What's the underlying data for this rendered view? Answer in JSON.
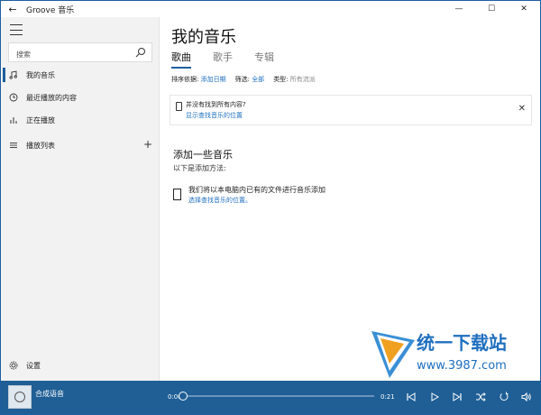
{
  "window": {
    "title": "Groove 音乐",
    "back_glyph": "←",
    "minimize_glyph": "—",
    "maximize_glyph": "☐",
    "close_glyph": "✕"
  },
  "sidebar": {
    "search_placeholder": "搜索",
    "items": [
      {
        "label": "我的音乐",
        "icon": "music-note-icon",
        "active": true
      },
      {
        "label": "最近播放的内容",
        "icon": "clock-icon"
      },
      {
        "label": "正在播放",
        "icon": "bars-icon"
      },
      {
        "label": "播放列表",
        "icon": "list-icon"
      }
    ],
    "add_playlist_glyph": "+",
    "settings_label": "设置"
  },
  "main": {
    "title": "我的音乐",
    "tabs": [
      {
        "label": "歌曲",
        "active": true
      },
      {
        "label": "歌手"
      },
      {
        "label": "专辑"
      }
    ],
    "filters": {
      "sort_label": "排序依据:",
      "sort_value": "添加日期",
      "filter_label": "筛选:",
      "filter_value": "全部",
      "type_label": "类型:",
      "type_value": "所有流派"
    },
    "notice": {
      "line1": "并没有找到所有内容?",
      "line2": "显示查找音乐的位置",
      "close_glyph": "✕"
    },
    "add_section": {
      "title": "添加一些音乐",
      "subtitle": "以下是添加方法:",
      "row1": "我们将以本电脑内已有的文件进行音乐添加",
      "row2": "选择查找音乐的位置。"
    },
    "watermark": {
      "brand": "统一下载站",
      "url": "www.3987.com"
    }
  },
  "player": {
    "track_name": "合成语音",
    "time_current": "0:00",
    "time_total": "0:21",
    "progress": 0.0
  },
  "colors": {
    "accent": "#1f5f9f",
    "link": "#1f6fbf",
    "player_bg": "#1f5f96",
    "sidebar_bg": "#f2f2f2"
  }
}
